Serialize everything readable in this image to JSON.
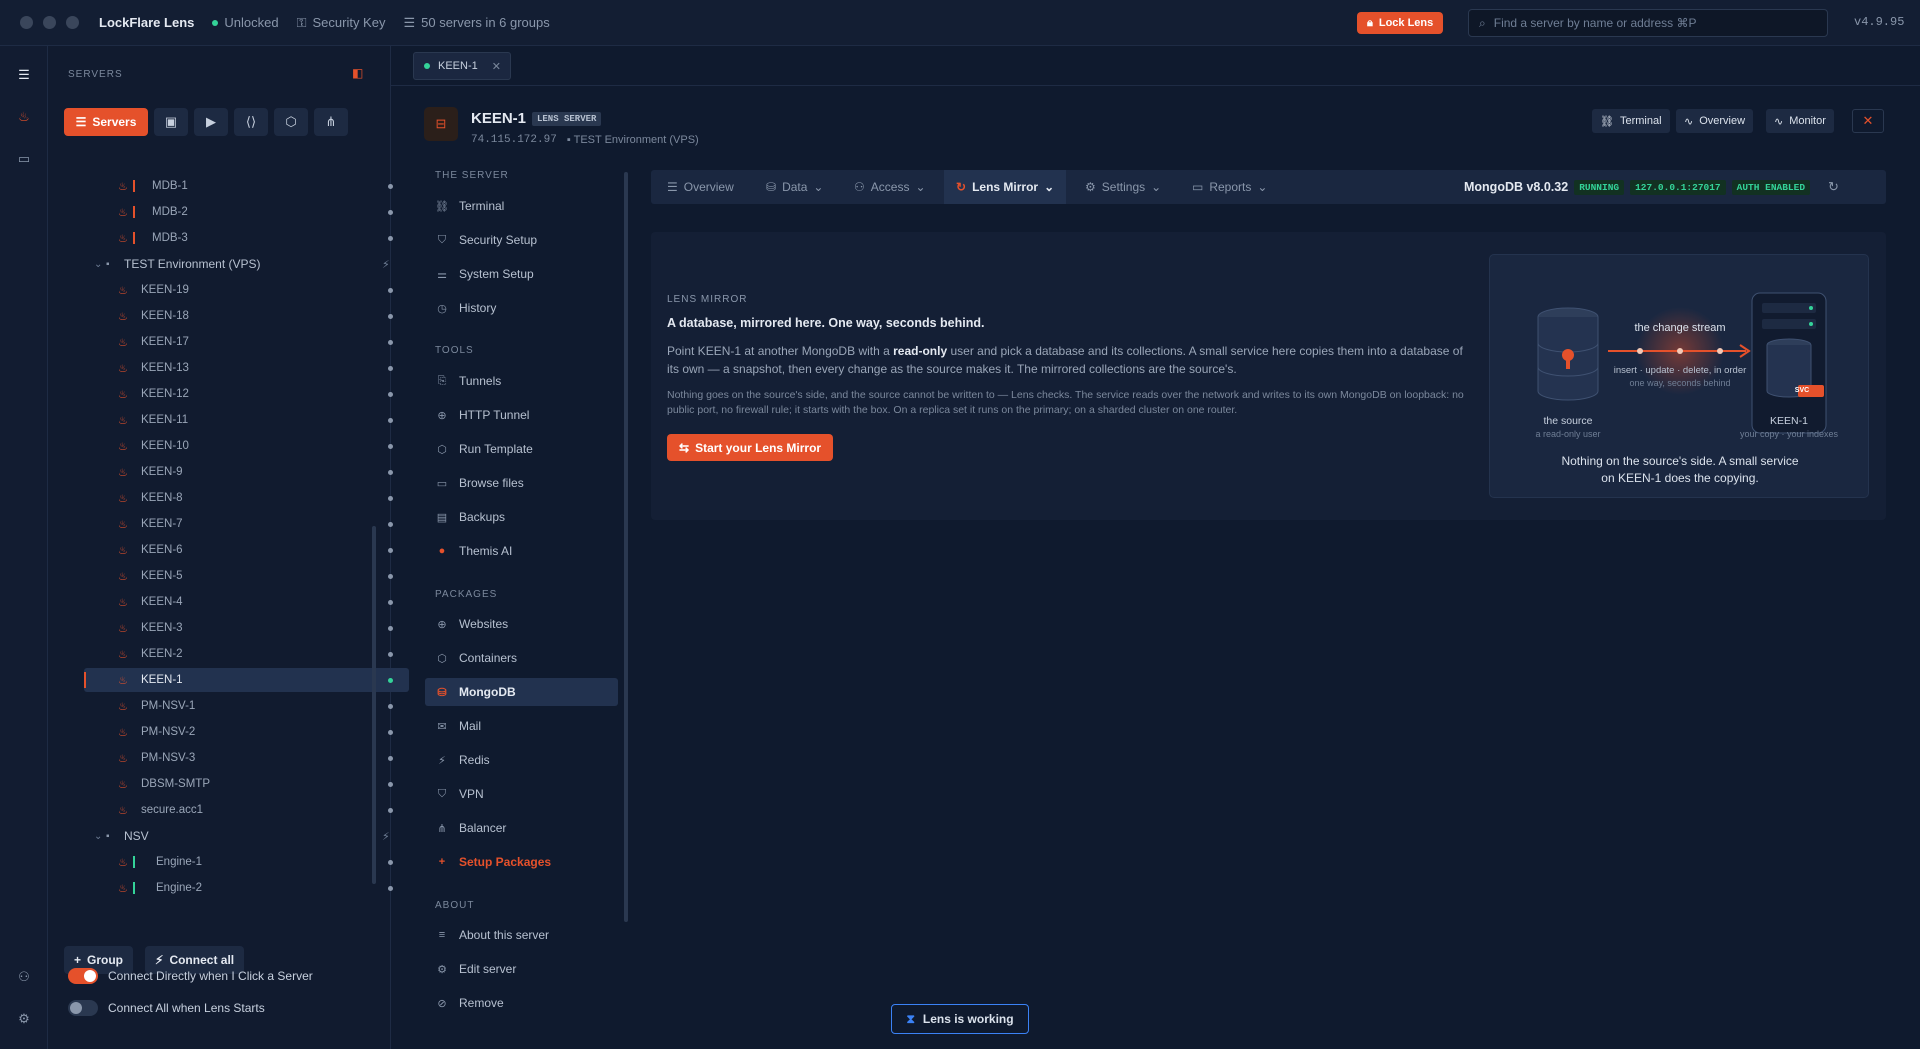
{
  "titlebar": {
    "app_name": "LockFlare Lens",
    "lock_state": "Unlocked",
    "security_key": "Security Key",
    "servers_count": "50 servers in 6 groups",
    "lock_button": "Lock Lens",
    "search_placeholder": "Find a server by name or address ⌘P",
    "version": "v4.9.95"
  },
  "sidebar": {
    "header": "SERVERS",
    "servers_button": "Servers",
    "tree": [
      {
        "label": "MDB-1",
        "bar": true
      },
      {
        "label": "MDB-2",
        "bar": true
      },
      {
        "label": "MDB-3",
        "bar": true
      },
      {
        "group": "TEST Environment (VPS)"
      },
      {
        "label": "KEEN-19"
      },
      {
        "label": "KEEN-18"
      },
      {
        "label": "KEEN-17"
      },
      {
        "label": "KEEN-13"
      },
      {
        "label": "KEEN-12"
      },
      {
        "label": "KEEN-11"
      },
      {
        "label": "KEEN-10"
      },
      {
        "label": "KEEN-9"
      },
      {
        "label": "KEEN-8"
      },
      {
        "label": "KEEN-7"
      },
      {
        "label": "KEEN-6"
      },
      {
        "label": "KEEN-5"
      },
      {
        "label": "KEEN-4"
      },
      {
        "label": "KEEN-3"
      },
      {
        "label": "KEEN-2"
      },
      {
        "label": "KEEN-1",
        "selected": true
      },
      {
        "label": "PM-NSV-1"
      },
      {
        "label": "PM-NSV-2"
      },
      {
        "label": "PM-NSV-3"
      },
      {
        "label": "DBSM-SMTP"
      },
      {
        "label": "secure.acc1"
      },
      {
        "group": "NSV"
      },
      {
        "label": "Engine-1",
        "bar": true,
        "barColor": "#34d399"
      },
      {
        "label": "Engine-2",
        "bar": true,
        "barColor": "#34d399"
      }
    ],
    "group_button": "Group",
    "connect_all_button": "Connect all",
    "toggle_direct": "Connect Directly when I Click a Server",
    "toggle_all": "Connect All when Lens Starts"
  },
  "file_tab": "KEEN-1",
  "server": {
    "name": "KEEN-1",
    "badge": "LENS SERVER",
    "ip": "74.115.172.97",
    "env": "TEST Environment (VPS)",
    "btn_terminal": "Terminal",
    "btn_overview": "Overview",
    "btn_monitor": "Monitor"
  },
  "nav": {
    "sec_server": "THE SERVER",
    "sec_tools": "TOOLS",
    "sec_packages": "PACKAGES",
    "sec_about": "ABOUT",
    "server_items": [
      "Terminal",
      "Security Setup",
      "System Setup",
      "History"
    ],
    "tool_items": [
      "Tunnels",
      "HTTP Tunnel",
      "Run Template",
      "Browse files",
      "Backups",
      "Themis AI"
    ],
    "package_items": [
      "Websites",
      "Containers",
      "MongoDB",
      "Mail",
      "Redis",
      "VPN",
      "Balancer",
      "Setup Packages"
    ],
    "about_items": [
      "About this server",
      "Edit server",
      "Remove"
    ]
  },
  "content_tabs": {
    "overview": "Overview",
    "data": "Data",
    "access": "Access",
    "lens_mirror": "Lens Mirror",
    "settings": "Settings",
    "reports": "Reports"
  },
  "mongo": {
    "version": "MongoDB v8.0.32",
    "running": "RUNNING",
    "address": "127.0.0.1:27017",
    "auth": "AUTH ENABLED"
  },
  "panel": {
    "kicker": "LENS MIRROR",
    "headline": "A database, mirrored here. One way, seconds behind.",
    "body_pre": "Point KEEN-1 at another MongoDB with a ",
    "body_bold": "read-only",
    "body_post": " user and pick a database and its collections. A small service here copies them into a database of its own — a snapshot, then every change as the source makes it. The mirrored collections are the source's.",
    "small": "Nothing goes on the source's side, and the source cannot be written to — Lens checks. The service reads over the network and writes to its own MongoDB on loopback: no public port, no firewall rule; it starts with the box. On a replica set it runs on the primary; on a sharded cluster on one router.",
    "start_button": "Start your Lens Mirror"
  },
  "diagram": {
    "stream_label": "the change stream",
    "ops": "insert · update · delete, in order",
    "lag": "one way, seconds behind",
    "source_label": "the source",
    "source_sub": "a read-only user",
    "target_label": "KEEN-1",
    "target_sub": "your copy · your indexes",
    "svc": "SVC",
    "caption": "Nothing on the source's side. A small service on KEEN-1 does the copying."
  },
  "status": "Lens is working",
  "colors": {
    "accent": "#e5512b",
    "ok": "#34d399",
    "info": "#3b82f6"
  }
}
